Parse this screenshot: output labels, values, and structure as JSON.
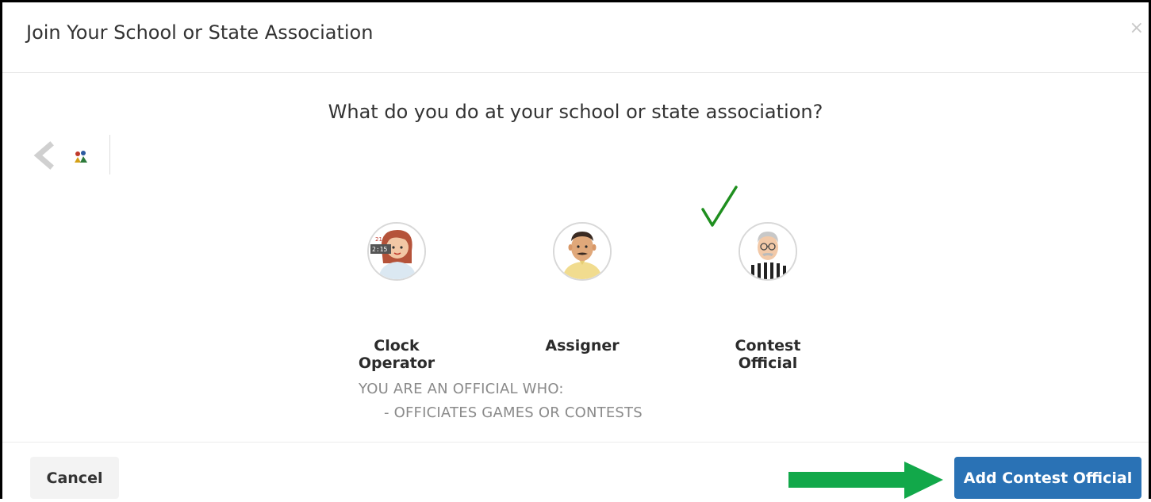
{
  "modal": {
    "title": "Join Your School or State Association",
    "close_label": "×"
  },
  "question": "What do you do at your school or state association?",
  "icons": {
    "back": "chevron-left-icon",
    "school": "school-logo-icon",
    "selected": "check-icon",
    "arrow": "arrow-right-icon"
  },
  "roles": [
    {
      "label": "Clock Operator",
      "selected": false
    },
    {
      "label": "Assigner",
      "selected": false
    },
    {
      "label": "Contest Official",
      "selected": true
    }
  ],
  "description": {
    "line1": "YOU ARE AN OFFICIAL WHO:",
    "line2": "- OFFICIATES GAMES OR CONTESTS"
  },
  "footer": {
    "cancel_label": "Cancel",
    "primary_label": "Add Contest Official"
  },
  "colors": {
    "primary": "#2a72b5",
    "check": "#1f8f1f",
    "arrow": "#12a84a"
  }
}
